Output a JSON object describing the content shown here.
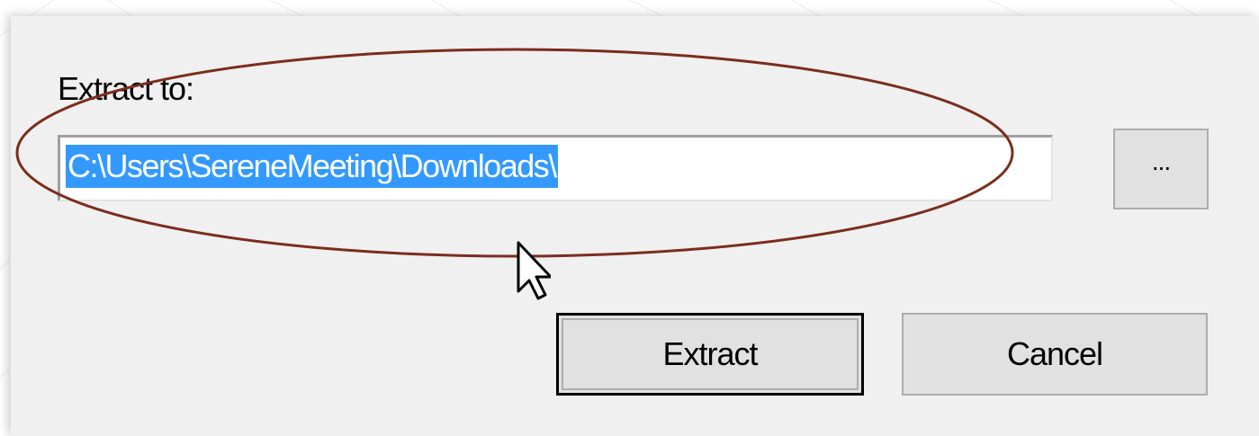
{
  "dialog": {
    "extract_label": "Extract to:",
    "path_value": "C:\\Users\\SereneMeeting\\Downloads\\",
    "browse_label": "...",
    "extract_button": "Extract",
    "cancel_button": "Cancel"
  },
  "annotation": {
    "shape": "ellipse",
    "color": "#7b2d1e"
  },
  "colors": {
    "dialog_bg": "#f0f0f0",
    "selection": "#3399ff",
    "button_bg": "#e1e1e1"
  },
  "icons": {
    "cursor": "arrow-cursor-icon"
  }
}
